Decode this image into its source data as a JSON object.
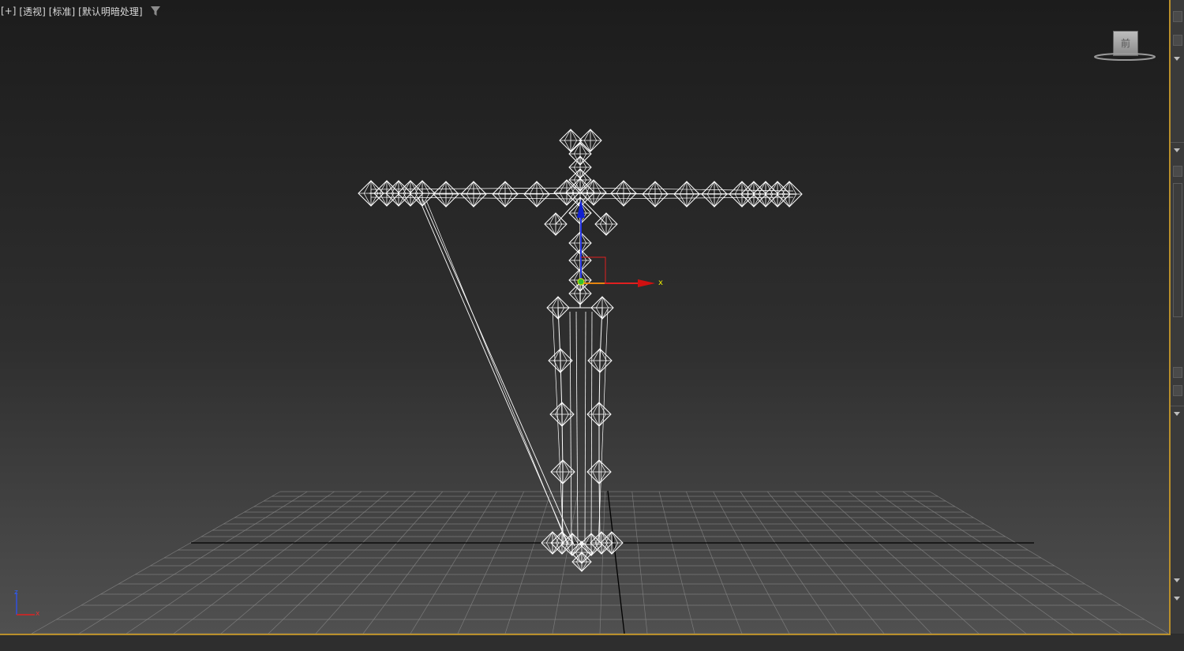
{
  "viewport": {
    "labels": [
      "[+]",
      "[透视]",
      "[标准]",
      "[默认明暗处理]"
    ],
    "filter_icon": "funnel-filter-icon",
    "viewcube_label": "前",
    "axis_labels": {
      "x": "x",
      "z": "z"
    },
    "corner_axis": {
      "x": "x",
      "z": "z"
    }
  },
  "colors": {
    "viewport_border": "#b98f2b",
    "wireframe": "#ffffff",
    "grid": "#8a8a8a",
    "axis_x": "#e02020",
    "axis_y": "#30c030",
    "axis_z": "#2030e0",
    "gizmo_yellow": "#e8e800"
  }
}
